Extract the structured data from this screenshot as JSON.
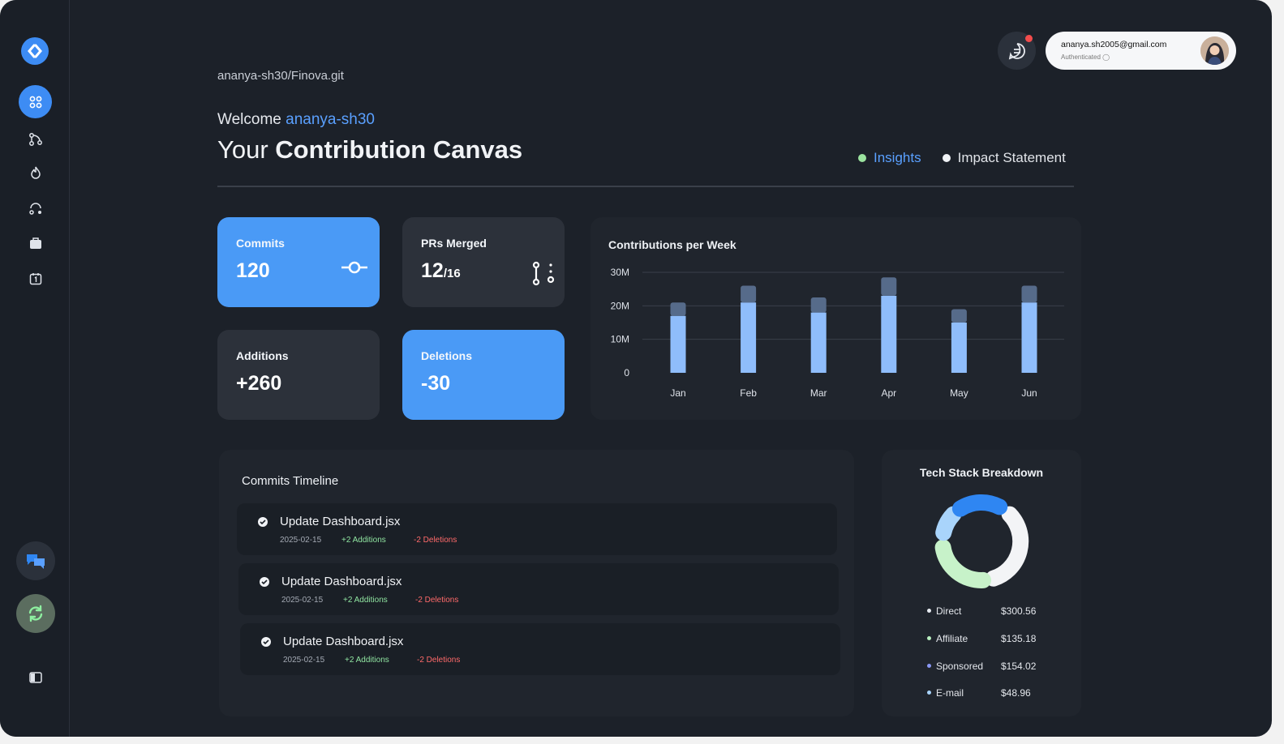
{
  "header": {
    "repo": "ananya-sh30/Finova.git",
    "welcome_prefix": "Welcome",
    "username": "ananya-sh30",
    "headline_prefix": "Your",
    "headline_strong": "Contribution Canvas"
  },
  "tabs": [
    {
      "label": "Insights",
      "dot_color": "#9be39f",
      "active": true
    },
    {
      "label": "Impact Statement",
      "dot_color": "#f1f3f6",
      "active": false
    }
  ],
  "account": {
    "email": "ananya.sh2005@gmail.com",
    "status": "Authenticated"
  },
  "stats": {
    "commits": {
      "label": "Commits",
      "value": "120"
    },
    "prs": {
      "label": "PRs Merged",
      "value": "12",
      "total": "/16"
    },
    "additions": {
      "label": "Additions",
      "value": "+260"
    },
    "deletions": {
      "label": "Deletions",
      "value": "-30"
    }
  },
  "chart_data": {
    "type": "bar",
    "title": "Contributions per Week",
    "categories": [
      "Jan",
      "Feb",
      "Mar",
      "Apr",
      "May",
      "Jun"
    ],
    "series": [
      {
        "values": [
          17,
          21,
          18,
          23,
          15,
          21
        ],
        "color": "#8fbdfb"
      },
      {
        "values": [
          4,
          5,
          4.5,
          5.5,
          4,
          5
        ],
        "color": "#566b8a"
      }
    ],
    "stacked": true,
    "yticks": [
      "0",
      "10M",
      "20M",
      "30M"
    ],
    "ylim": [
      0,
      30
    ],
    "grid": true
  },
  "timeline": {
    "title": "Commits Timeline",
    "items": [
      {
        "message": "Update Dashboard.jsx",
        "date": "2025-02-15",
        "additions": "+2 Additions",
        "deletions": "-2 Deletions"
      },
      {
        "message": "Update Dashboard.jsx",
        "date": "2025-02-15",
        "additions": "+2 Additions",
        "deletions": "-2 Deletions"
      },
      {
        "message": "Update Dashboard.jsx",
        "date": "2025-02-15",
        "additions": "+2 Additions",
        "deletions": "-2 Deletions"
      }
    ]
  },
  "tech_stack": {
    "title": "Tech Stack Breakdown",
    "items": [
      {
        "name": "Direct",
        "value": "$300.56",
        "color": "#e8ecf2"
      },
      {
        "name": "Affiliate",
        "value": "$135.18",
        "color": "#b9f0c0"
      },
      {
        "name": "Sponsored",
        "value": "$154.02",
        "color": "#8a98f4"
      },
      {
        "name": "E-mail",
        "value": "$48.96",
        "color": "#a9d4fb"
      }
    ],
    "donut_colors": [
      "#2f86f2",
      "#f3f4f6",
      "#c7f2c9",
      "#a9d4fb"
    ]
  }
}
